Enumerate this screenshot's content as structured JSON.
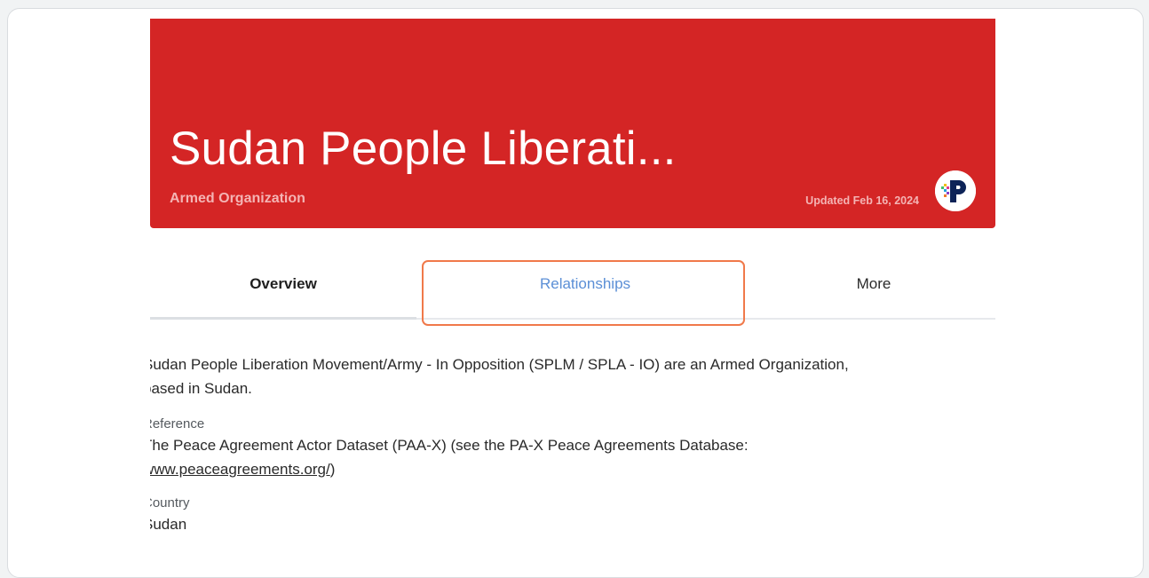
{
  "header": {
    "title": "Sudan People Liberati...",
    "subtitle": "Armed Organization",
    "updated": "Updated Feb 16, 2024",
    "logo_icon": "pax-logo-icon",
    "background_color": "#d42525"
  },
  "tabs": [
    {
      "label": "Overview",
      "state": "active"
    },
    {
      "label": "Relationships",
      "state": "highlighted"
    },
    {
      "label": "More",
      "state": "default"
    }
  ],
  "highlight_color": "#f0794a",
  "content": {
    "description_line1": "Sudan People Liberation Movement/Army - In Opposition (SPLM / SPLA - IO) are an Armed Organization,",
    "description_line2": "based in Sudan.",
    "reference_label": "Reference",
    "reference_text": "The Peace Agreement Actor Dataset (PAA-X) (see the PA-X Peace Agreements Database:",
    "reference_link": "www.peaceagreements.org/",
    "reference_close": ")",
    "country_label": "Country",
    "country_value": "Sudan"
  }
}
